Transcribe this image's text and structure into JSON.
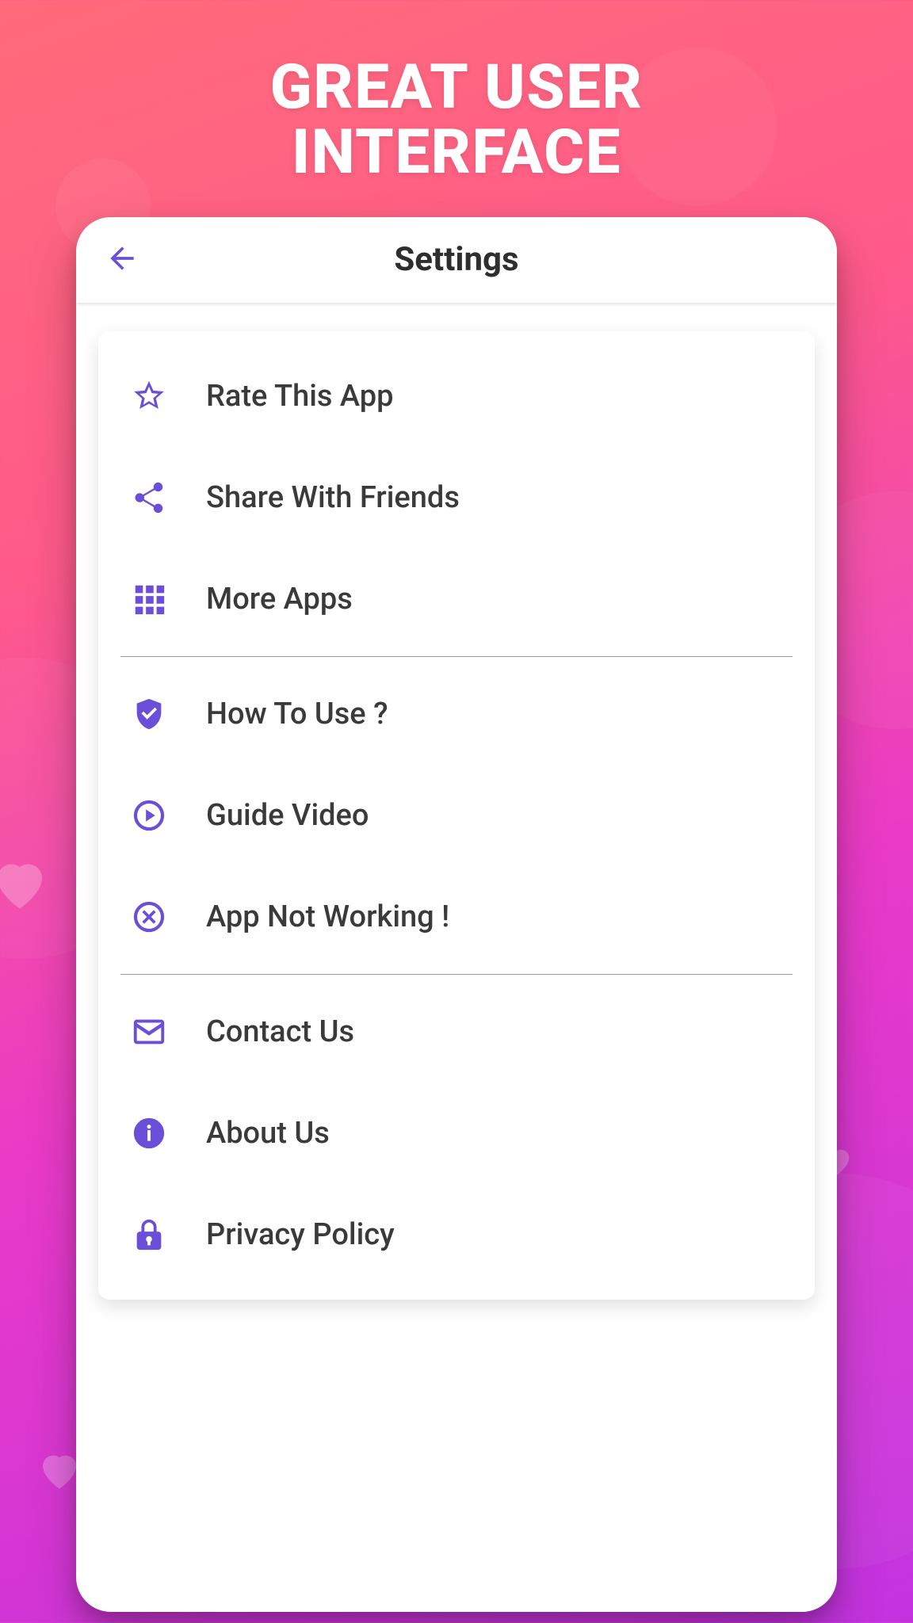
{
  "promo": {
    "line1": "GREAT USER",
    "line2": "INTERFACE"
  },
  "header": {
    "title": "Settings"
  },
  "menu": {
    "group1": [
      {
        "id": "rate",
        "icon": "star-icon",
        "label": "Rate This App"
      },
      {
        "id": "share",
        "icon": "share-icon",
        "label": "Share With Friends"
      },
      {
        "id": "more",
        "icon": "grid-icon",
        "label": "More Apps"
      }
    ],
    "group2": [
      {
        "id": "howto",
        "icon": "shield-check-icon",
        "label": "How To Use ?"
      },
      {
        "id": "guide",
        "icon": "play-circle-icon",
        "label": "Guide Video"
      },
      {
        "id": "notwork",
        "icon": "close-circle-icon",
        "label": " App Not Working !"
      }
    ],
    "group3": [
      {
        "id": "contact",
        "icon": "mail-icon",
        "label": "Contact Us"
      },
      {
        "id": "about",
        "icon": "info-icon",
        "label": "About Us"
      },
      {
        "id": "privacy",
        "icon": "lock-icon",
        "label": "Privacy Policy"
      }
    ]
  },
  "colors": {
    "accent": "#6c4fd8"
  }
}
